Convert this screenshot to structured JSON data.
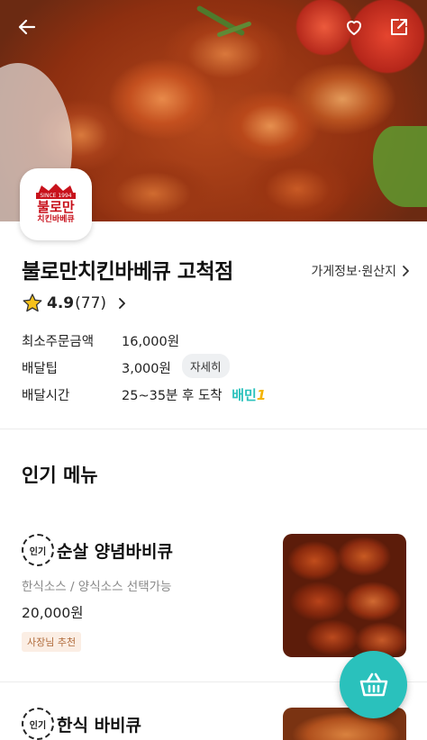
{
  "colors": {
    "brand": "#2ac1bc",
    "logo_red": "#c8121c"
  },
  "header": {
    "back_icon": "arrow-left-icon",
    "favorite_icon": "heart-icon",
    "share_icon": "share-icon"
  },
  "logo": {
    "since": "SINCE 1994",
    "brand_top": "불로만",
    "brand_bottom": "치킨바베큐"
  },
  "store": {
    "name": "불로만치킨바베큐 고척점",
    "info_link": "가게정보·원산지"
  },
  "rating": {
    "score": "4.9",
    "count": "(77)"
  },
  "info": {
    "min_order_label": "최소주문금액",
    "min_order_value": "16,000원",
    "delivery_tip_label": "배달팁",
    "delivery_tip_value": "3,000원",
    "detail_button": "자세히",
    "delivery_time_label": "배달시간",
    "delivery_time_value": "25~35분 후 도착",
    "baemin_label": "배민",
    "baemin_one": "1"
  },
  "section": {
    "popular_title": "인기 메뉴"
  },
  "menu": [
    {
      "badge": "인기",
      "name": "순살 양념바비큐",
      "desc": "한식소스 / 양식소스 선택가능",
      "price": "20,000원",
      "tag": "사장님 추천"
    },
    {
      "badge": "인기",
      "name": "한식 바비큐"
    }
  ],
  "cart": {
    "icon": "basket-icon"
  }
}
